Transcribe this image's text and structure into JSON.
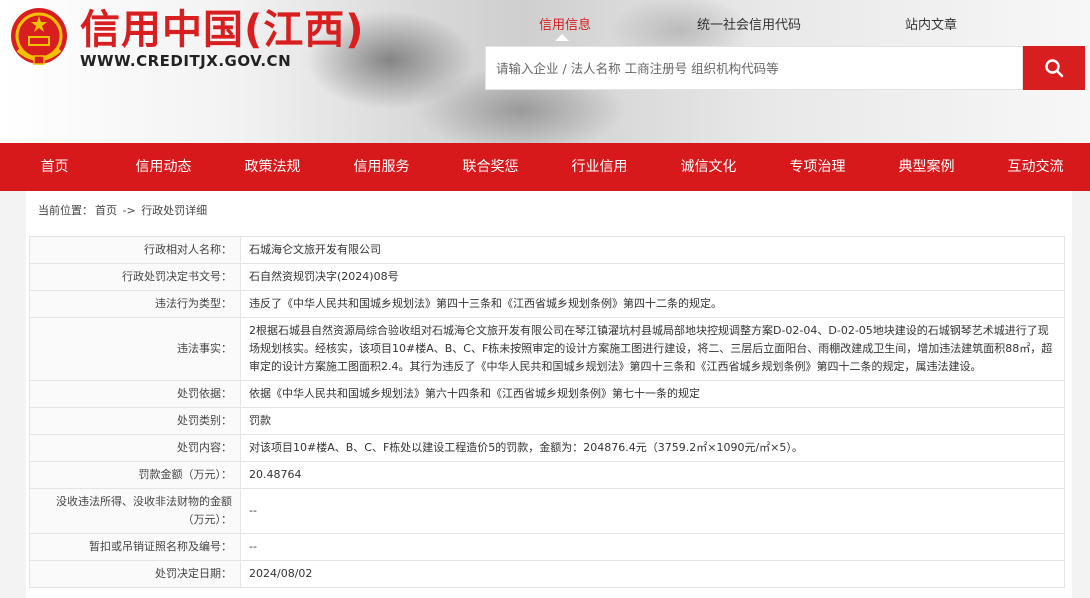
{
  "header": {
    "site_title": "信用中国(江西)",
    "site_url": "WWW.CREDITJX.GOV.CN",
    "search_tabs": [
      {
        "label": "信用信息",
        "active": true
      },
      {
        "label": "统一社会信用代码",
        "active": false
      },
      {
        "label": "站内文章",
        "active": false
      }
    ],
    "search_placeholder": "请输入企业 / 法人名称 工商注册号 组织机构代码等",
    "search_icon": "search-icon"
  },
  "colors": {
    "brand_red": "#d81e1e",
    "nav_red": "#d7191b"
  },
  "nav": [
    "首页",
    "信用动态",
    "政策法规",
    "信用服务",
    "联合奖惩",
    "行业信用",
    "诚信文化",
    "专项治理",
    "典型案例",
    "互动交流"
  ],
  "breadcrumb": {
    "prefix": "当前位置：",
    "items": [
      "首页",
      "->",
      "行政处罚详细"
    ]
  },
  "detail": [
    {
      "label": "行政相对人名称：",
      "value": "石城海仑文旅开发有限公司"
    },
    {
      "label": "行政处罚决定书文号：",
      "value": "石自然资规罚决字(2024)08号"
    },
    {
      "label": "违法行为类型：",
      "value": "违反了《中华人民共和国城乡规划法》第四十三条和《江西省城乡规划条例》第四十二条的规定。"
    },
    {
      "label": "违法事实：",
      "value": "2根据石城县自然资源局综合验收组对石城海仑文旅开发有限公司在琴江镇濯坑村县城局部地块控规调整方案D-02-04、D-02-05地块建设的石城钢琴艺术城进行了现场规划核实。经核实，该项目10#楼A、B、C、F栋未按照审定的设计方案施工图进行建设，将二、三层后立面阳台、雨棚改建成卫生间，增加违法建筑面积88㎡，超审定的设计方案施工图面积2.4。其行为违反了《中华人民共和国城乡规划法》第四十三条和《江西省城乡规划条例》第四十二条的规定，属违法建设。"
    },
    {
      "label": "处罚依据：",
      "value": "依据《中华人民共和国城乡规划法》第六十四条和《江西省城乡规划条例》第七十一条的规定"
    },
    {
      "label": "处罚类别：",
      "value": "罚款"
    },
    {
      "label": "处罚内容：",
      "value": "对该项目10#楼A、B、C、F栋处以建设工程造价5的罚款，金额为：204876.4元（3759.2㎡×1090元/㎡×5）。"
    },
    {
      "label": "罚款金额（万元）：",
      "value": "20.48764"
    },
    {
      "label": "没收违法所得、没收非法财物的金额（万元）：",
      "value": "--"
    },
    {
      "label": "暂扣或吊销证照名称及编号：",
      "value": "--"
    },
    {
      "label": "处罚决定日期：",
      "value": "2024/08/02"
    }
  ]
}
